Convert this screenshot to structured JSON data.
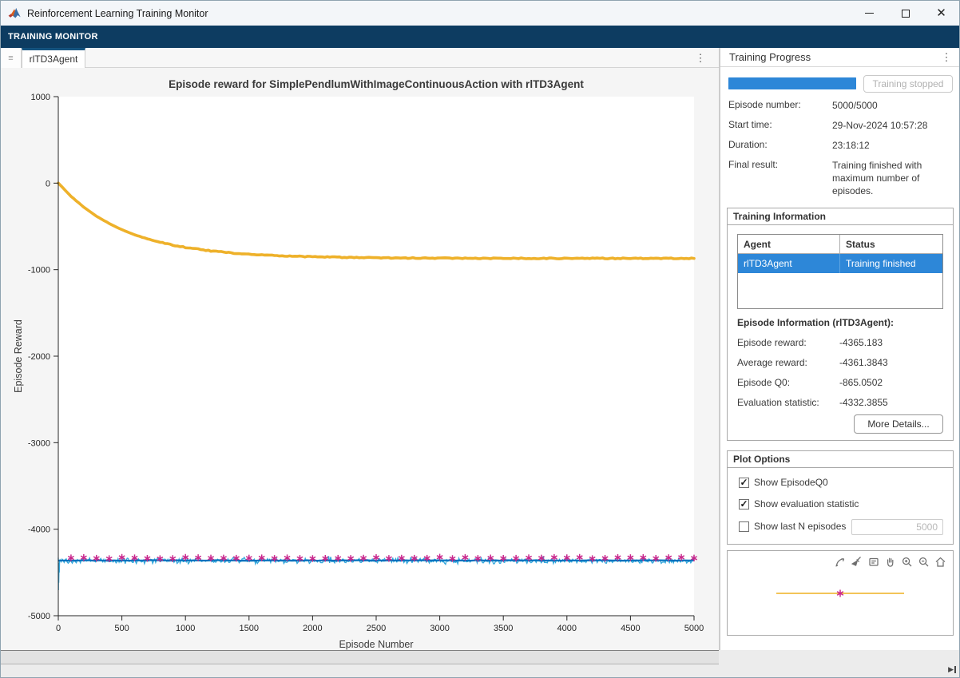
{
  "window": {
    "title": "Reinforcement Learning Training Monitor",
    "controls": [
      "minimize",
      "maximize",
      "close"
    ]
  },
  "toolstrip": {
    "label": "TRAINING MONITOR"
  },
  "tab_bar": {
    "tabs": [
      {
        "label": "rlTD3Agent",
        "active": true
      }
    ]
  },
  "chart_data": {
    "type": "line",
    "title": "Episode reward for SimplePendlumWithImageContinuousAction with rlTD3Agent",
    "xlabel": "Episode Number",
    "ylabel": "Episode Reward",
    "xlim": [
      0,
      5000
    ],
    "ylim": [
      -5000,
      1000
    ],
    "xticks": [
      0,
      500,
      1000,
      1500,
      2000,
      2500,
      3000,
      3500,
      4000,
      4500,
      5000
    ],
    "yticks": [
      1000,
      0,
      -1000,
      -2000,
      -3000,
      -4000,
      -5000
    ],
    "grid": false,
    "legend": "none",
    "series": [
      {
        "name": "EpisodeReward",
        "style": "noisy-line",
        "color": "#35a8dc",
        "mean": -4365.183,
        "noise_amplitude": 38,
        "spike_points": [
          [
            0,
            -4330
          ],
          [
            1,
            -4705
          ],
          [
            2,
            -4450
          ],
          [
            4,
            -4620
          ],
          [
            6,
            -4390
          ],
          [
            8,
            -4500
          ],
          [
            10,
            -4370
          ]
        ]
      },
      {
        "name": "AverageReward",
        "style": "flat-line",
        "color": "#0072bd",
        "mean": -4361.3843,
        "wobble": 3
      },
      {
        "name": "EpisodeQ0",
        "style": "decay-line",
        "color": "#eeb12a",
        "points": [
          [
            0,
            0
          ],
          [
            100,
            -152
          ],
          [
            200,
            -278
          ],
          [
            300,
            -381
          ],
          [
            400,
            -467
          ],
          [
            500,
            -537
          ],
          [
            600,
            -596
          ],
          [
            700,
            -644
          ],
          [
            800,
            -683
          ],
          [
            900,
            -716
          ],
          [
            1000,
            -743
          ],
          [
            1200,
            -783
          ],
          [
            1400,
            -811
          ],
          [
            1600,
            -830
          ],
          [
            1800,
            -843
          ],
          [
            2000,
            -851
          ],
          [
            2250,
            -858
          ],
          [
            2500,
            -863
          ],
          [
            2750,
            -866
          ],
          [
            3000,
            -867
          ],
          [
            3500,
            -869
          ],
          [
            4000,
            -870
          ],
          [
            4500,
            -870
          ],
          [
            5000,
            -870
          ]
        ]
      },
      {
        "name": "EvaluationStatistic",
        "style": "asterisk-markers",
        "color": "#c9278c",
        "x_start": 100,
        "x_step": 100,
        "value": -4332.3855,
        "jitter": 9
      }
    ]
  },
  "right_panel": {
    "header": {
      "title": "Training Progress"
    },
    "progress": {
      "percent": 100,
      "button_label": "Training stopped"
    },
    "fields": [
      {
        "label": "Episode number:",
        "value": "5000/5000"
      },
      {
        "label": "Start time:",
        "value": "29-Nov-2024 10:57:28"
      },
      {
        "label": "Duration:",
        "value": "23:18:12"
      },
      {
        "label": "Final result:",
        "value": "Training finished with maximum number of episodes."
      }
    ],
    "training_information": {
      "title": "Training Information",
      "table": {
        "columns": [
          "Agent",
          "Status"
        ],
        "rows": [
          {
            "agent": "rlTD3Agent",
            "status": "Training finished",
            "selected": true
          }
        ]
      },
      "episode_info_title": "Episode Information (rlTD3Agent):",
      "fields": [
        {
          "label": "Episode reward:",
          "value": "-4365.183"
        },
        {
          "label": "Average reward:",
          "value": "-4361.3843"
        },
        {
          "label": "Episode Q0:",
          "value": "-865.0502"
        },
        {
          "label": "Evaluation statistic:",
          "value": "-4332.3855"
        }
      ],
      "more_details_label": "More Details..."
    },
    "plot_options": {
      "title": "Plot Options",
      "checkboxes": [
        {
          "label": "Show EpisodeQ0",
          "checked": true
        },
        {
          "label": "Show evaluation statistic",
          "checked": true
        },
        {
          "label": "Show last N episodes",
          "checked": false
        }
      ],
      "last_n_value": "5000"
    },
    "mini_plot": {
      "toolbar_icons": [
        "export-icon",
        "brush-icon",
        "datatip-icon",
        "pan-icon",
        "zoom-in-icon",
        "zoom-out-icon",
        "restore-view-icon"
      ],
      "line_color": "#edb120",
      "marker_color": "#c9278c"
    }
  },
  "icons": {
    "check": "✓",
    "ellipsis": "⋮",
    "grip": "≡",
    "skip_end": "▶"
  },
  "colors": {
    "toolstrip": "#0d3c61",
    "accent_blue": "#2d87d8",
    "tab_accent": "#14527e"
  }
}
